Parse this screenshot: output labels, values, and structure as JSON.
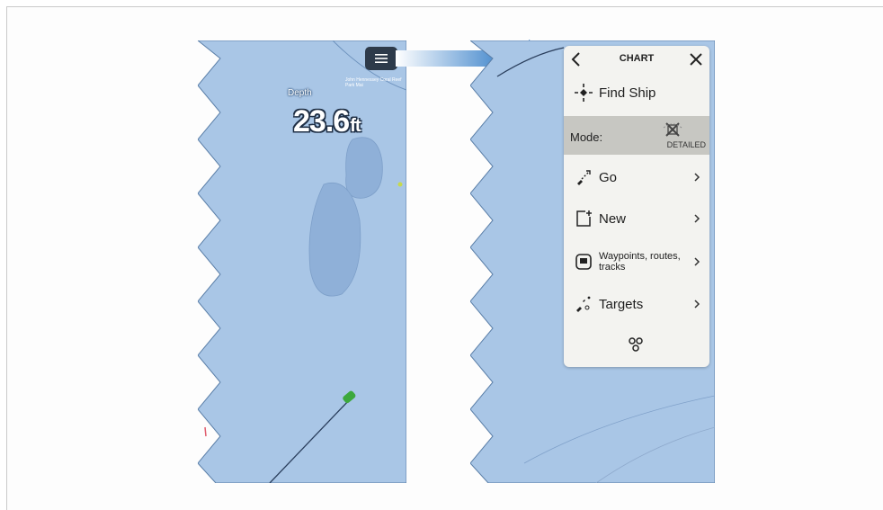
{
  "left_panel": {
    "depth_label": "Depth",
    "depth_value": "23.6",
    "depth_unit": "ft",
    "map_note": "John Hennessey Coral Reef Park Mai",
    "menu_button_icon": "hamburger-menu-icon"
  },
  "chart_menu": {
    "title": "CHART",
    "back_icon": "chevron-left-icon",
    "close_icon": "close-icon",
    "find_ship_label": "Find Ship",
    "mode_label": "Mode:",
    "mode_value": "DETAILED",
    "items": [
      {
        "label": "Go",
        "icon": "go-icon"
      },
      {
        "label": "New",
        "icon": "new-icon"
      },
      {
        "label": "Waypoints, routes, tracks",
        "icon": "waypoints-icon"
      },
      {
        "label": "Targets",
        "icon": "targets-icon"
      }
    ],
    "bottom_icon": "layers-icon"
  },
  "colors": {
    "chart_water": "#a9c6e6",
    "chart_shallow": "#8fb0d8",
    "menu_bg": "#f3f3f0",
    "menu_button": "#2d3a4a",
    "arrow": "#2a6fb8"
  }
}
